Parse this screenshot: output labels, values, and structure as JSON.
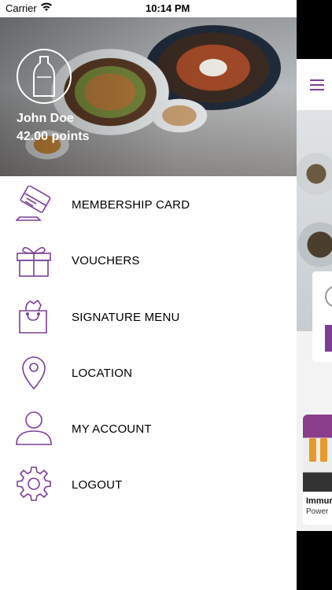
{
  "status_bar": {
    "carrier": "Carrier",
    "time": "10:14 PM"
  },
  "profile": {
    "name": "John Doe",
    "points": "42.00 points"
  },
  "menu": [
    {
      "label": "MEMBERSHIP CARD",
      "icon": "membership-card-icon"
    },
    {
      "label": "VOUCHERS",
      "icon": "gift-icon"
    },
    {
      "label": "SIGNATURE MENU",
      "icon": "shopping-bag-icon"
    },
    {
      "label": "LOCATION",
      "icon": "location-pin-icon"
    },
    {
      "label": "MY ACCOUNT",
      "icon": "user-icon"
    },
    {
      "label": "LOGOUT",
      "icon": "gear-icon"
    }
  ],
  "background_screen": {
    "tile_title": "Immur",
    "tile_subtitle": "Power"
  },
  "colors": {
    "accent": "#7b3f98",
    "text": "#000000",
    "header_text": "#ffffff"
  }
}
